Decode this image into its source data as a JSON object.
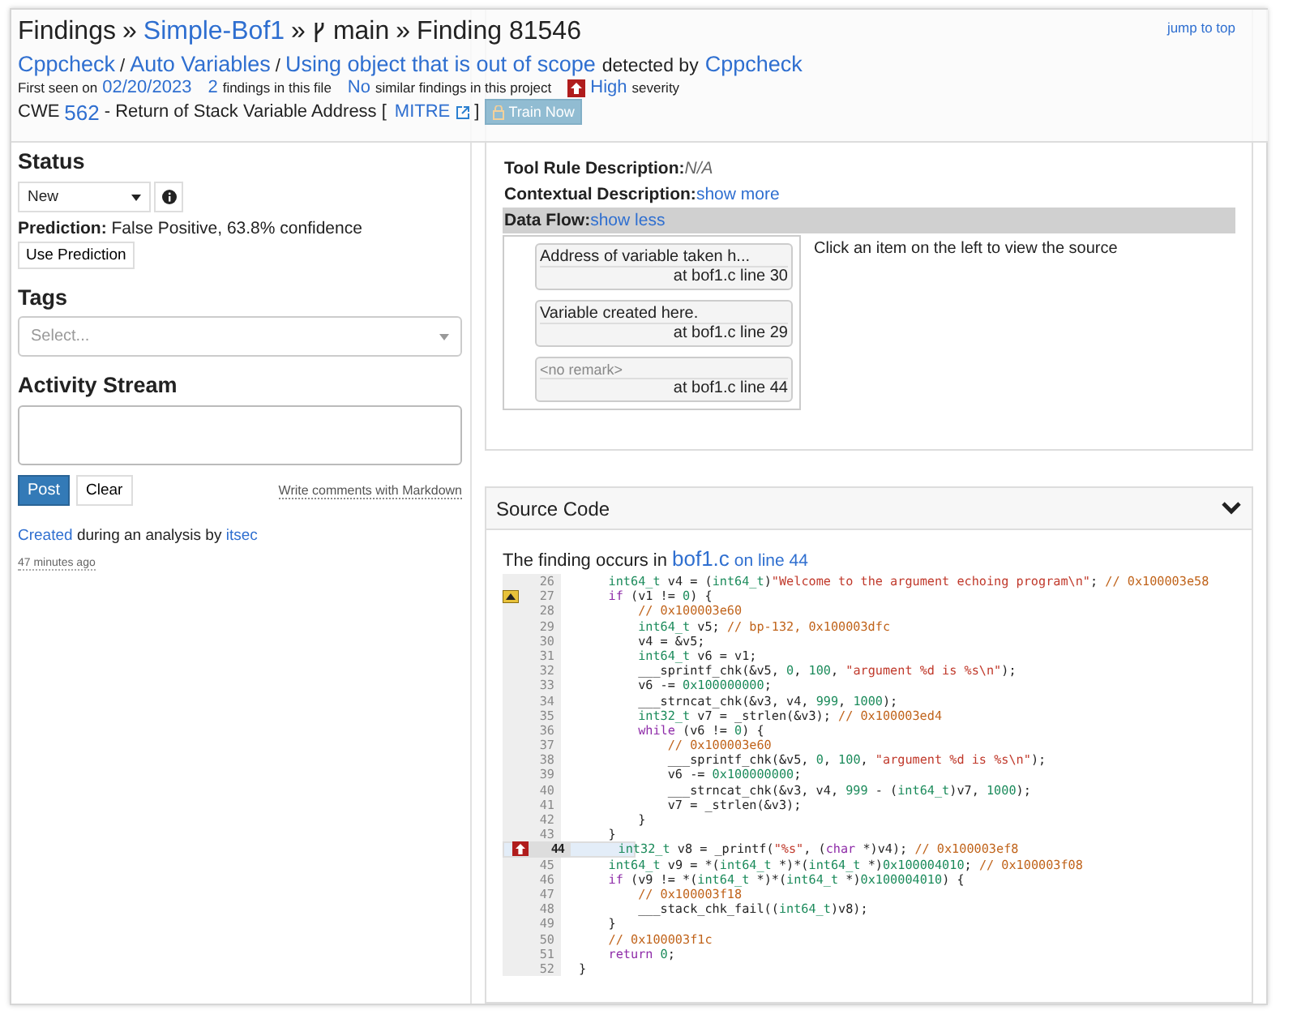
{
  "header": {
    "breadcrumb": {
      "root": "Findings",
      "separator": "»",
      "project": "Simple-Bof1",
      "branch": "main",
      "finding": "Finding 81546"
    },
    "classification": {
      "tool": "Cppcheck",
      "category": "Auto Variables",
      "rule": "Using object that is out of scope",
      "slash": "/",
      "detected_by": "detected by",
      "detector": "Cppcheck"
    },
    "meta": {
      "first_seen_label": "First seen on",
      "first_seen": "02/20/2023",
      "file_count": "2",
      "file_count_label": "findings in this file",
      "similar": "No",
      "similar_label": "similar findings in this project",
      "severity": "High",
      "severity_label": "severity"
    },
    "cwe": {
      "label": "CWE",
      "id": "562",
      "title": "- Return of Stack Variable Address [",
      "link": "MITRE",
      "close": "]",
      "train_button": {
        "label": "Train Now",
        "disabled": true
      }
    },
    "jump_to_top": "jump to top"
  },
  "details": {
    "rows": [
      {
        "kind": "text",
        "label": "Tool Rule Description:",
        "value": "N/A"
      },
      {
        "kind": "toggle",
        "label": "Contextual Description:",
        "value": "show more",
        "expanded": false
      },
      {
        "kind": "toggle",
        "label": "Data Flow:",
        "value": "show less",
        "expanded": true
      }
    ],
    "data_flow": {
      "steps": [
        {
          "remark": "Address of variable taken h...",
          "location": "at bof1.c line 30",
          "muted": false
        },
        {
          "remark": "Variable created here.",
          "location": "at bof1.c line 29",
          "muted": false
        },
        {
          "remark": "<no remark>",
          "location": "at bof1.c line 44",
          "muted": true
        }
      ],
      "hint": "Click an item on the left to view the source"
    }
  },
  "status": {
    "heading": "Status",
    "value": "New",
    "prediction_label": "Prediction:",
    "prediction": "False Positive, 63.8% confidence",
    "use_prediction": "Use Prediction"
  },
  "tags": {
    "heading": "Tags",
    "placeholder": "Select..."
  },
  "activity": {
    "heading": "Activity Stream",
    "post": "Post",
    "clear": "Clear",
    "markdown": "Write comments with Markdown",
    "entries": [
      {
        "action": "Created",
        "text": "during an analysis by",
        "user": "itsec",
        "time": "47 minutes ago"
      }
    ]
  },
  "source": {
    "heading": "Source Code",
    "expanded": true,
    "intro": "The finding occurs in",
    "file": "bof1.c",
    "line_link": "on line 44",
    "lines": [
      {
        "number": "26",
        "kind": "plain",
        "selected": false,
        "tokens": [
          {
            "kind": "type",
            "text": "    int64_t"
          },
          {
            "kind": "plain",
            "text": " v4 = ("
          },
          {
            "kind": "type",
            "text": "int64_t"
          },
          {
            "kind": "plain",
            "text": ")"
          },
          {
            "kind": "string",
            "text": "\"Welcome to the argument echoing program\\n\""
          },
          {
            "kind": "plain",
            "text": "; "
          },
          {
            "kind": "comment",
            "text": "// 0x100003e58"
          }
        ]
      },
      {
        "number": "27",
        "kind": "warning",
        "selected": false,
        "tokens": [
          {
            "kind": "keyword",
            "text": "    if"
          },
          {
            "kind": "plain",
            "text": " (v1 != "
          },
          {
            "kind": "number",
            "text": "0"
          },
          {
            "kind": "plain",
            "text": ") {"
          }
        ]
      },
      {
        "number": "28",
        "kind": "plain",
        "selected": false,
        "tokens": [
          {
            "kind": "comment",
            "text": "        // 0x100003e60"
          }
        ]
      },
      {
        "number": "29",
        "kind": "plain",
        "selected": false,
        "tokens": [
          {
            "kind": "type",
            "text": "        int64_t"
          },
          {
            "kind": "plain",
            "text": " v5; "
          },
          {
            "kind": "comment",
            "text": "// bp-132, 0x100003dfc"
          }
        ]
      },
      {
        "number": "30",
        "kind": "plain",
        "selected": false,
        "tokens": [
          {
            "kind": "plain",
            "text": "        v4 = &v5;"
          }
        ]
      },
      {
        "number": "31",
        "kind": "plain",
        "selected": false,
        "tokens": [
          {
            "kind": "type",
            "text": "        int64_t"
          },
          {
            "kind": "plain",
            "text": " v6 = v1;"
          }
        ]
      },
      {
        "number": "32",
        "kind": "plain",
        "selected": false,
        "tokens": [
          {
            "kind": "plain",
            "text": "        ___sprintf_chk(&v5, "
          },
          {
            "kind": "number",
            "text": "0"
          },
          {
            "kind": "plain",
            "text": ", "
          },
          {
            "kind": "number",
            "text": "100"
          },
          {
            "kind": "plain",
            "text": ", "
          },
          {
            "kind": "string",
            "text": "\"argument %d is %s\\n\""
          },
          {
            "kind": "plain",
            "text": ");"
          }
        ]
      },
      {
        "number": "33",
        "kind": "plain",
        "selected": false,
        "tokens": [
          {
            "kind": "plain",
            "text": "        v6 -= "
          },
          {
            "kind": "number",
            "text": "0x100000000"
          },
          {
            "kind": "plain",
            "text": ";"
          }
        ]
      },
      {
        "number": "34",
        "kind": "plain",
        "selected": false,
        "tokens": [
          {
            "kind": "plain",
            "text": "        ___strncat_chk(&v3, v4, "
          },
          {
            "kind": "number",
            "text": "999"
          },
          {
            "kind": "plain",
            "text": ", "
          },
          {
            "kind": "number",
            "text": "1000"
          },
          {
            "kind": "plain",
            "text": ");"
          }
        ]
      },
      {
        "number": "35",
        "kind": "plain",
        "selected": false,
        "tokens": [
          {
            "kind": "type",
            "text": "        int32_t"
          },
          {
            "kind": "plain",
            "text": " v7 = _strlen(&v3); "
          },
          {
            "kind": "comment",
            "text": "// 0x100003ed4"
          }
        ]
      },
      {
        "number": "36",
        "kind": "plain",
        "selected": false,
        "tokens": [
          {
            "kind": "keyword",
            "text": "        while"
          },
          {
            "kind": "plain",
            "text": " (v6 != "
          },
          {
            "kind": "number",
            "text": "0"
          },
          {
            "kind": "plain",
            "text": ") {"
          }
        ]
      },
      {
        "number": "37",
        "kind": "plain",
        "selected": false,
        "tokens": [
          {
            "kind": "comment",
            "text": "            // 0x100003e60"
          }
        ]
      },
      {
        "number": "38",
        "kind": "plain",
        "selected": false,
        "tokens": [
          {
            "kind": "plain",
            "text": "            ___sprintf_chk(&v5, "
          },
          {
            "kind": "number",
            "text": "0"
          },
          {
            "kind": "plain",
            "text": ", "
          },
          {
            "kind": "number",
            "text": "100"
          },
          {
            "kind": "plain",
            "text": ", "
          },
          {
            "kind": "string",
            "text": "\"argument %d is %s\\n\""
          },
          {
            "kind": "plain",
            "text": ");"
          }
        ]
      },
      {
        "number": "39",
        "kind": "plain",
        "selected": false,
        "tokens": [
          {
            "kind": "plain",
            "text": "            v6 -= "
          },
          {
            "kind": "number",
            "text": "0x100000000"
          },
          {
            "kind": "plain",
            "text": ";"
          }
        ]
      },
      {
        "number": "40",
        "kind": "plain",
        "selected": false,
        "tokens": [
          {
            "kind": "plain",
            "text": "            ___strncat_chk(&v3, v4, "
          },
          {
            "kind": "number",
            "text": "999"
          },
          {
            "kind": "plain",
            "text": " - ("
          },
          {
            "kind": "type",
            "text": "int64_t"
          },
          {
            "kind": "plain",
            "text": ")v7, "
          },
          {
            "kind": "number",
            "text": "1000"
          },
          {
            "kind": "plain",
            "text": ");"
          }
        ]
      },
      {
        "number": "41",
        "kind": "plain",
        "selected": false,
        "tokens": [
          {
            "kind": "plain",
            "text": "            v7 = _strlen(&v3);"
          }
        ]
      },
      {
        "number": "42",
        "kind": "plain",
        "selected": false,
        "tokens": [
          {
            "kind": "plain",
            "text": "        }"
          }
        ]
      },
      {
        "number": "43",
        "kind": "plain",
        "selected": false,
        "tokens": [
          {
            "kind": "plain",
            "text": "    }"
          }
        ]
      },
      {
        "number": "44",
        "kind": "finding",
        "selected": true,
        "tokens": [
          {
            "kind": "type",
            "text": "    int32_t"
          },
          {
            "kind": "plain",
            "text": " v8 = _printf("
          },
          {
            "kind": "string",
            "text": "\"%s\""
          },
          {
            "kind": "plain",
            "text": ", ("
          },
          {
            "kind": "keyword",
            "text": "char"
          },
          {
            "kind": "plain",
            "text": " *)v4); "
          },
          {
            "kind": "comment",
            "text": "// 0x100003ef8"
          }
        ]
      },
      {
        "number": "45",
        "kind": "plain",
        "selected": false,
        "tokens": [
          {
            "kind": "type",
            "text": "    int64_t"
          },
          {
            "kind": "plain",
            "text": " v9 = *("
          },
          {
            "kind": "type",
            "text": "int64_t"
          },
          {
            "kind": "plain",
            "text": " *)*("
          },
          {
            "kind": "type",
            "text": "int64_t"
          },
          {
            "kind": "plain",
            "text": " *)"
          },
          {
            "kind": "number",
            "text": "0x100004010"
          },
          {
            "kind": "plain",
            "text": "; "
          },
          {
            "kind": "comment",
            "text": "// 0x100003f08"
          }
        ]
      },
      {
        "number": "46",
        "kind": "plain",
        "selected": false,
        "tokens": [
          {
            "kind": "keyword",
            "text": "    if"
          },
          {
            "kind": "plain",
            "text": " (v9 != *("
          },
          {
            "kind": "type",
            "text": "int64_t"
          },
          {
            "kind": "plain",
            "text": " *)*("
          },
          {
            "kind": "type",
            "text": "int64_t"
          },
          {
            "kind": "plain",
            "text": " *)"
          },
          {
            "kind": "number",
            "text": "0x100004010"
          },
          {
            "kind": "plain",
            "text": ") {"
          }
        ]
      },
      {
        "number": "47",
        "kind": "plain",
        "selected": false,
        "tokens": [
          {
            "kind": "comment",
            "text": "        // 0x100003f18"
          }
        ]
      },
      {
        "number": "48",
        "kind": "plain",
        "selected": false,
        "tokens": [
          {
            "kind": "plain",
            "text": "        ___stack_chk_fail(("
          },
          {
            "kind": "type",
            "text": "int64_t"
          },
          {
            "kind": "plain",
            "text": ")v8);"
          }
        ]
      },
      {
        "number": "49",
        "kind": "plain",
        "selected": false,
        "tokens": [
          {
            "kind": "plain",
            "text": "    }"
          }
        ]
      },
      {
        "number": "50",
        "kind": "plain",
        "selected": false,
        "tokens": [
          {
            "kind": "comment",
            "text": "    // 0x100003f1c"
          }
        ]
      },
      {
        "number": "51",
        "kind": "plain",
        "selected": false,
        "tokens": [
          {
            "kind": "keyword",
            "text": "    return"
          },
          {
            "kind": "number",
            "text": " 0"
          },
          {
            "kind": "plain",
            "text": ";"
          }
        ]
      },
      {
        "number": "52",
        "kind": "plain",
        "selected": false,
        "tokens": [
          {
            "kind": "plain",
            "text": "}"
          }
        ]
      }
    ]
  }
}
